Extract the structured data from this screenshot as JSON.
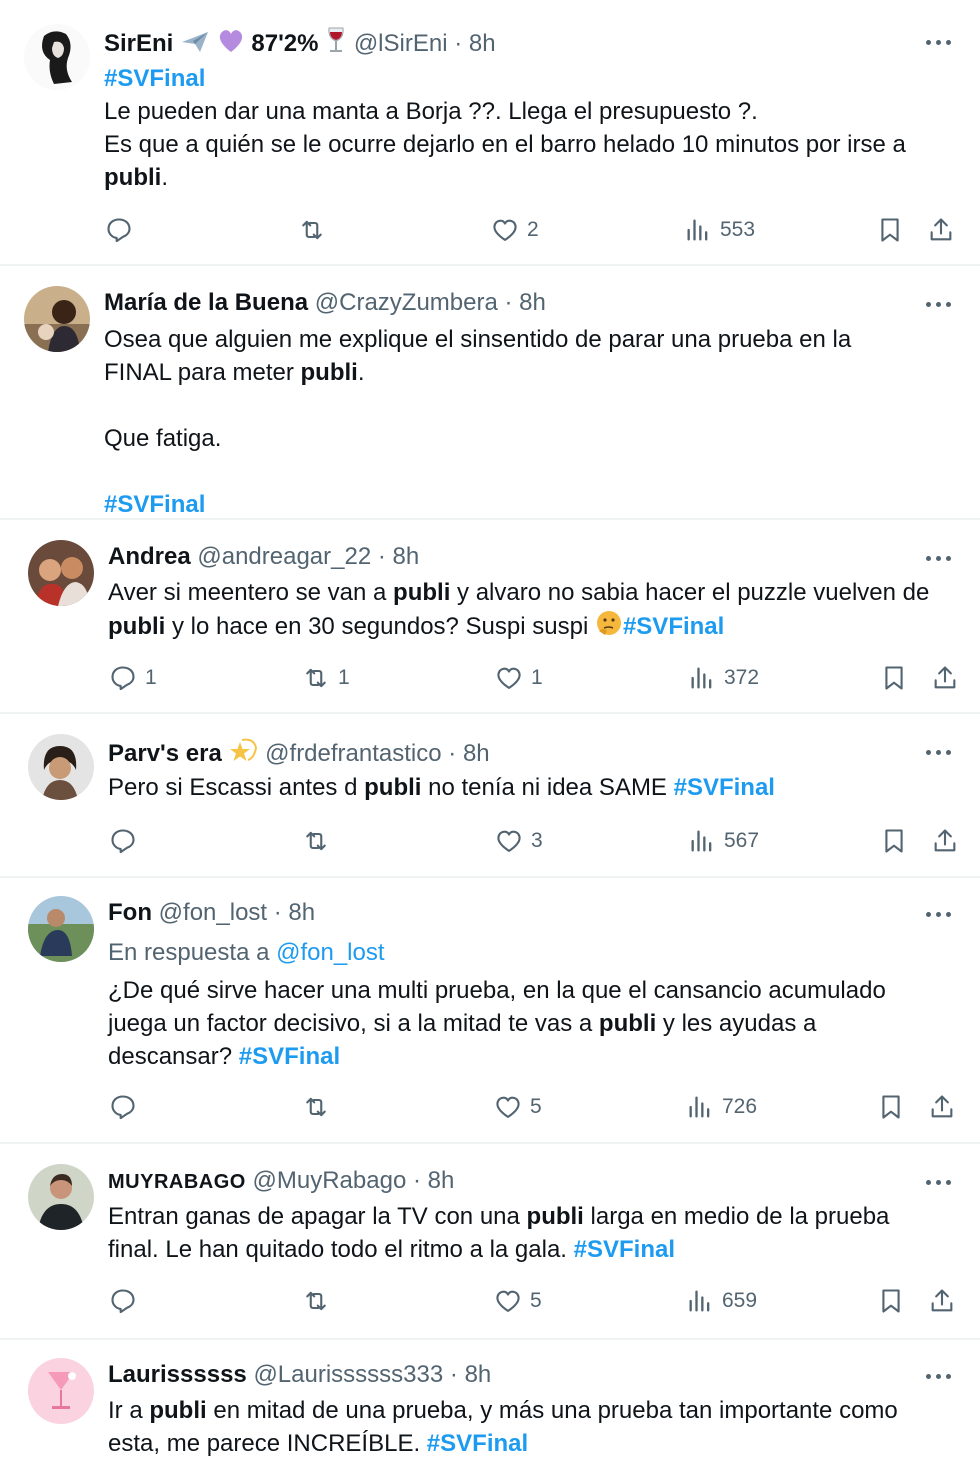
{
  "colors": {
    "link": "#1d9bf0",
    "muted": "#536471",
    "text": "#0f1419"
  },
  "icons": [
    "reply-icon",
    "retweet-icon",
    "like-icon",
    "views-icon",
    "bookmark-icon",
    "share-icon",
    "more-icon"
  ],
  "tweets": [
    {
      "name": "SirEni",
      "name_suffix": "87'2%",
      "handle": "@lSirEni",
      "time": "8h",
      "hashtag_line": "#SVFinal",
      "line1": "Le pueden dar una manta a Borja ??. Llega el presupuesto ?.",
      "line2": "Es que a quién se le ocurre dejarlo en el barro helado 10 minutos por irse a",
      "bold_word": "publi",
      "end": ".",
      "reply_count": "",
      "retweet_count": "",
      "like_count": "2",
      "view_count": "553"
    },
    {
      "name": "María de la Buena",
      "handle": "@CrazyZumbera",
      "time": "8h",
      "line1": "Osea que alguien me explique el sinsentido de parar una prueba en la",
      "line2_pre": "FINAL para meter ",
      "bold_word": "publi",
      "line2_end": ".",
      "line3": "Que fatiga.",
      "hashtag": "#SVFinal"
    },
    {
      "name": "Andrea",
      "handle": "@andreagar_22",
      "time": "8h",
      "line1_pre": "Aver si meentero se van a ",
      "bold_word": "publi",
      "line1_post": " y alvaro no sabia hacer el puzzle vuelven de",
      "line2_post": " y lo hace en 30 segundos? Suspi suspi ",
      "hashtag": "#SVFinal",
      "reply_count": "1",
      "retweet_count": "1",
      "like_count": "1",
      "view_count": "372"
    },
    {
      "name": "Parv's era",
      "handle": "@frdefrantastico",
      "time": "8h",
      "line1_pre": "Pero si Escassi antes d ",
      "bold_word": "publi",
      "line1_post": " no tenía ni idea SAME ",
      "hashtag": "#SVFinal",
      "reply_count": "",
      "retweet_count": "",
      "like_count": "3",
      "view_count": "567"
    },
    {
      "name": "Fon",
      "handle": "@fon_lost",
      "time": "8h",
      "reply_prefix": "En respuesta a ",
      "reply_mention": "@fon_lost",
      "line1": "¿De qué sirve hacer una multi prueba, en la que el cansancio acumulado",
      "line2_pre": "juega un factor decisivo, si a la mitad te vas a ",
      "bold_word": "publi",
      "line2_post": " y les ayudas a",
      "line3_pre": "descansar? ",
      "hashtag": "#SVFinal",
      "reply_count": "",
      "retweet_count": "",
      "like_count": "5",
      "view_count": "726"
    },
    {
      "name": "MUYRABAGO",
      "handle": "@MuyRabago",
      "time": "8h",
      "line1_pre": "Entran ganas de apagar la TV con una ",
      "bold_word": "publi",
      "line1_post": " larga en medio de la prueba",
      "line2_pre": "final. Le han quitado todo el ritmo a la gala. ",
      "hashtag": "#SVFinal",
      "reply_count": "",
      "retweet_count": "",
      "like_count": "5",
      "view_count": "659"
    },
    {
      "name": "Laurissssss",
      "handle": "@Laurissssss333",
      "time": "8h",
      "line1_pre": "Ir a ",
      "bold_word": "publi",
      "line1_post": " en mitad de una prueba, y más una prueba tan importante como",
      "line2_pre": "esta, me parece INCREÍBLE. ",
      "hashtag": "#SVFinal"
    }
  ]
}
